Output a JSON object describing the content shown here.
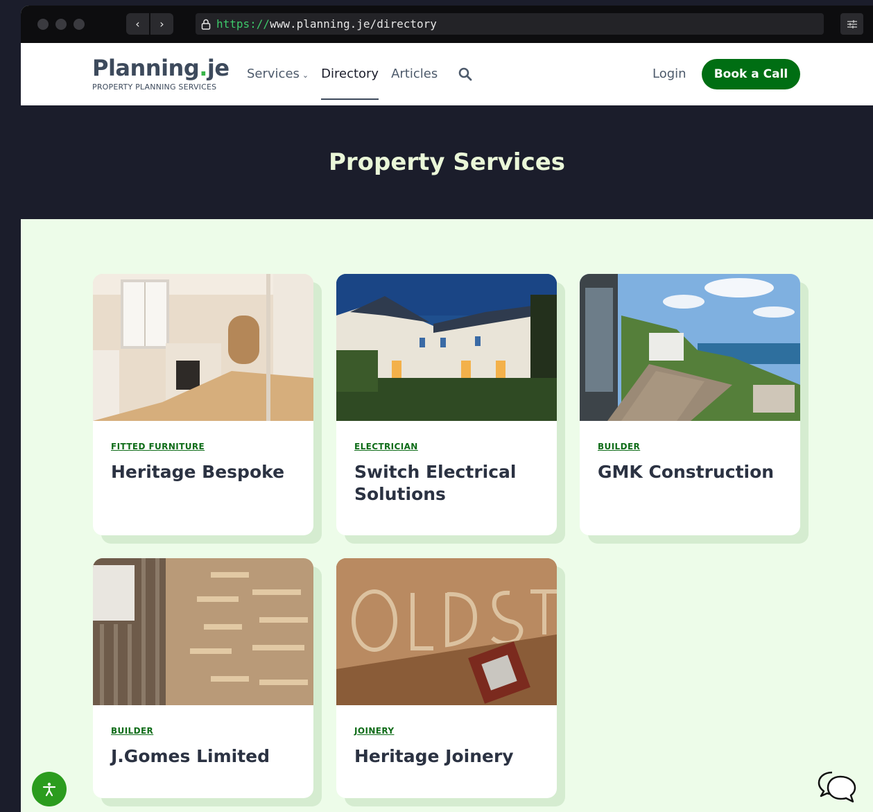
{
  "browser": {
    "back_label": "‹",
    "forward_label": "›",
    "url_scheme": "https://",
    "url_rest": "www.planning.je/directory",
    "icons": [
      "lock-icon",
      "settings-sliders-icon"
    ]
  },
  "header": {
    "logo_text": "Planning",
    "logo_dot": ".",
    "logo_suffix": "je",
    "logo_tagline": "PROPERTY PLANNING SERVICES",
    "nav": [
      {
        "label": "Services",
        "has_dropdown": true
      },
      {
        "label": "Directory",
        "active": true
      },
      {
        "label": "Articles"
      }
    ],
    "login_label": "Login",
    "cta_label": "Book a Call",
    "brand_green": "#006e13"
  },
  "hero": {
    "title": "Property Services"
  },
  "cards": [
    {
      "category": "FITTED FURNITURE",
      "title": "Heritage Bespoke",
      "image": "kitchen interior photo"
    },
    {
      "category": "ELECTRICIAN",
      "title": "Switch Electrical Solutions",
      "image": "house at dusk photo"
    },
    {
      "category": "BUILDER",
      "title": "GMK Construction",
      "image": "seaside terrace photo"
    },
    {
      "category": "BUILDER",
      "title": "J.Gomes Limited",
      "image": "wooden shelving photo"
    },
    {
      "category": "JOINERY",
      "title": "Heritage Joinery",
      "image": "carved wooden sign photo"
    }
  ],
  "colors": {
    "page_bg": "#edfce9",
    "hero_bg": "#1b1d2b",
    "accent": "#0e6c18"
  }
}
